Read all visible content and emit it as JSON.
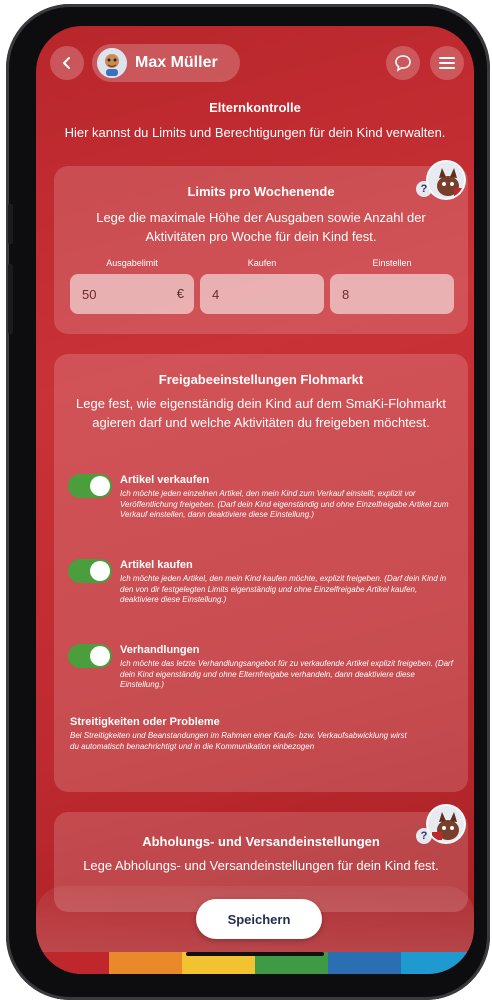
{
  "header": {
    "user_name": "Max Müller"
  },
  "page": {
    "title": "Elternkontrolle",
    "subtitle": "Hier kannst du Limits und Berechtigungen für dein Kind verwalten."
  },
  "limits": {
    "title": "Limits pro Wochenende",
    "description": "Lege die maximale Höhe der Ausgaben sowie Anzahl der Aktivitäten pro Woche für dein Kind fest.",
    "help": "?",
    "fields": [
      {
        "label": "Ausgabelimit",
        "value": "50",
        "unit": "€"
      },
      {
        "label": "Kaufen",
        "value": "4"
      },
      {
        "label": "Einstellen",
        "value": "8"
      }
    ]
  },
  "flohmarkt": {
    "title": "Freigabeeinstellungen Flohmarkt",
    "description": "Lege fest, wie eigenständig dein Kind auf dem SmaKi-Flohmarkt agieren darf und welche Aktivitäten du freigeben möchtest.",
    "permissions": [
      {
        "title": "Artikel verkaufen",
        "enabled": true,
        "description": "Ich möchte jeden einzelnen Artikel, den mein Kind zum Verkauf einstellt, explizit vor Veröffentlichung freigeben.  (Darf dein Kind eigenständig und ohne Einzelfreigabe Artikel zum Verkauf einstellen, dann deaktiviere diese Einstellung.)"
      },
      {
        "title": "Artikel kaufen",
        "enabled": true,
        "description": "Ich möchte jeden Artikel, den mein Kind kaufen möchte, explizit freigeben.  (Darf dein Kind in den von dir festgelegten Limits eigenständig und ohne Einzelfreigabe Artikel kaufen, deaktiviere diese Einstellung.)"
      },
      {
        "title": "Verhandlungen",
        "enabled": true,
        "description": "Ich möchte das letzte Verhandlungsangebot für zu verkaufende Artikel explizit freigeben.  (Darf dein Kind eigenständig und ohne Elternfreigabe verhandeln, dann deaktiviere diese Einstellung.)"
      }
    ],
    "dispute_title": "Streitigkeiten oder Probleme",
    "dispute_text": "Bei Streitigkeiten und Beanstandungen im Rahmen einer Kaufs- bzw. Verkaufsabwicklung wirst du automatisch benachrichtigt und in die Kommunikation einbezogen"
  },
  "abholung": {
    "title": "Abholungs- und Versandeinstellungen",
    "description": "Lege Abholungs- und Versandeinstellungen für dein Kind fest.",
    "help": "?"
  },
  "footer": {
    "save_label": "Speichern",
    "rainbow_colors": [
      "#c0272d",
      "#e9892a",
      "#f2c230",
      "#3f9a45",
      "#2b6fb3",
      "#1f9ad1"
    ]
  },
  "colors": {
    "background_red": "#c93237",
    "toggle_green": "#4a9e3c",
    "save_text": "#1f2d4e"
  },
  "icons": {
    "back": "chevron-left-icon",
    "chat": "chat-bubble-icon",
    "menu": "hamburger-menu-icon",
    "help": "question-mark-icon"
  }
}
